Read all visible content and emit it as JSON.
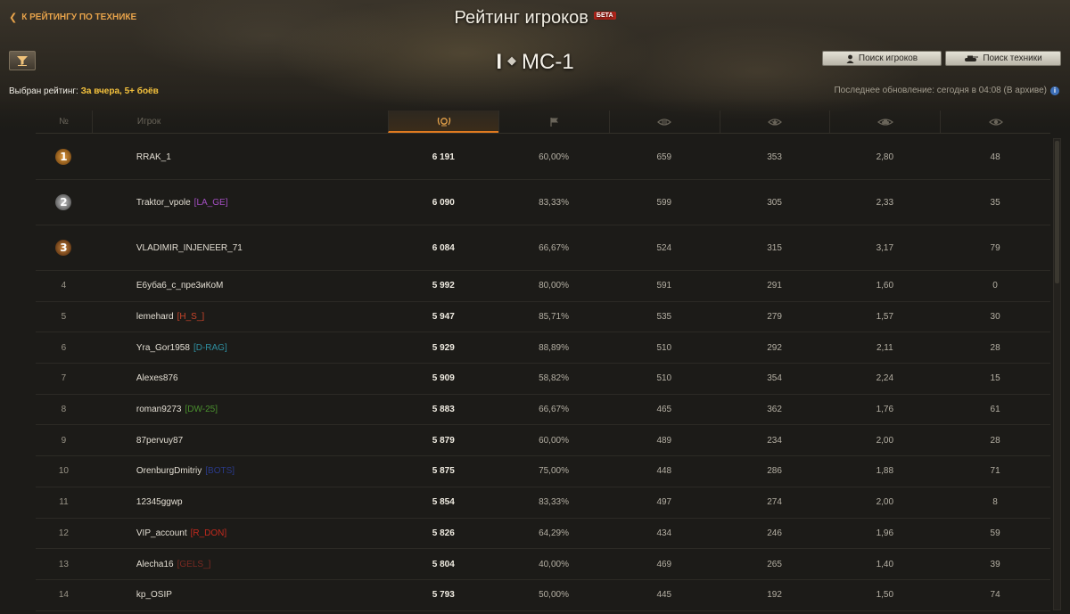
{
  "header": {
    "back_label": "К РЕЙТИНГУ ПО ТЕХНИКЕ",
    "title": "Рейтинг игроков",
    "beta": "БЕТА",
    "tank_tier": "I",
    "tank_class_icon": "light-tank-diamond-icon",
    "tank_name": "МС-1",
    "search_players_label": "Поиск игроков",
    "search_vehicles_label": "Поиск техники"
  },
  "rating": {
    "label": "Выбран рейтинг:",
    "value": "За вчера, 5+ боёв"
  },
  "last_update": "Последнее обновление: сегодня в 04:08 (В архиве)",
  "columns": {
    "num": "№",
    "player": "Игрок"
  },
  "rows": [
    {
      "rank": "1",
      "name": "RRAK_1",
      "clan": "",
      "clan_color": "",
      "score": "6 191",
      "winrate": "60,00%",
      "damage": "659",
      "xp": "353",
      "frags": "2,80",
      "spotted": "48"
    },
    {
      "rank": "2",
      "name": "Traktor_vpole",
      "clan": "[LA_GE]",
      "clan_color": "#a54fc4",
      "score": "6 090",
      "winrate": "83,33%",
      "damage": "599",
      "xp": "305",
      "frags": "2,33",
      "spotted": "35"
    },
    {
      "rank": "3",
      "name": "VLADIMIR_INJENEER_71",
      "clan": "",
      "clan_color": "",
      "score": "6 084",
      "winrate": "66,67%",
      "damage": "524",
      "xp": "315",
      "frags": "3,17",
      "spotted": "79"
    },
    {
      "rank": "4",
      "name": "Е6уба6_с_пре3иКоМ",
      "clan": "",
      "clan_color": "",
      "score": "5 992",
      "winrate": "80,00%",
      "damage": "591",
      "xp": "291",
      "frags": "1,60",
      "spotted": "0"
    },
    {
      "rank": "5",
      "name": "lemehard",
      "clan": "[H_S_]",
      "clan_color": "#c9452b",
      "score": "5 947",
      "winrate": "85,71%",
      "damage": "535",
      "xp": "279",
      "frags": "1,57",
      "spotted": "30"
    },
    {
      "rank": "6",
      "name": "Yra_Gor1958",
      "clan": "[D-RAG]",
      "clan_color": "#2f8fa0",
      "score": "5 929",
      "winrate": "88,89%",
      "damage": "510",
      "xp": "292",
      "frags": "2,11",
      "spotted": "28"
    },
    {
      "rank": "7",
      "name": "Alexes876",
      "clan": "",
      "clan_color": "",
      "score": "5 909",
      "winrate": "58,82%",
      "damage": "510",
      "xp": "354",
      "frags": "2,24",
      "spotted": "15"
    },
    {
      "rank": "8",
      "name": "roman9273",
      "clan": "[DW-25]",
      "clan_color": "#4a8f2e",
      "score": "5 883",
      "winrate": "66,67%",
      "damage": "465",
      "xp": "362",
      "frags": "1,76",
      "spotted": "61"
    },
    {
      "rank": "9",
      "name": "87pervuy87",
      "clan": "",
      "clan_color": "",
      "score": "5 879",
      "winrate": "60,00%",
      "damage": "489",
      "xp": "234",
      "frags": "2,00",
      "spotted": "28"
    },
    {
      "rank": "10",
      "name": "OrenburgDmitriy",
      "clan": "[BOTS]",
      "clan_color": "#2a3a8a",
      "score": "5 875",
      "winrate": "75,00%",
      "damage": "448",
      "xp": "286",
      "frags": "1,88",
      "spotted": "71"
    },
    {
      "rank": "11",
      "name": "12345ggwp",
      "clan": "",
      "clan_color": "",
      "score": "5 854",
      "winrate": "83,33%",
      "damage": "497",
      "xp": "274",
      "frags": "2,00",
      "spotted": "8"
    },
    {
      "rank": "12",
      "name": "VIP_account",
      "clan": "[R_DON]",
      "clan_color": "#c42a1e",
      "score": "5 826",
      "winrate": "64,29%",
      "damage": "434",
      "xp": "246",
      "frags": "1,96",
      "spotted": "59"
    },
    {
      "rank": "13",
      "name": "Alecha16",
      "clan": "[GELS_]",
      "clan_color": "#7a2a22",
      "score": "5 804",
      "winrate": "40,00%",
      "damage": "469",
      "xp": "265",
      "frags": "1,40",
      "spotted": "39"
    },
    {
      "rank": "14",
      "name": "kp_OSIP",
      "clan": "",
      "clan_color": "",
      "score": "5 793",
      "winrate": "50,00%",
      "damage": "445",
      "xp": "192",
      "frags": "1,50",
      "spotted": "74"
    }
  ],
  "colors": {
    "accent": "#e6a24a",
    "highlight": "#f5c23d",
    "active_column": "#e07a1f",
    "beta_badge": "#b2251b"
  }
}
